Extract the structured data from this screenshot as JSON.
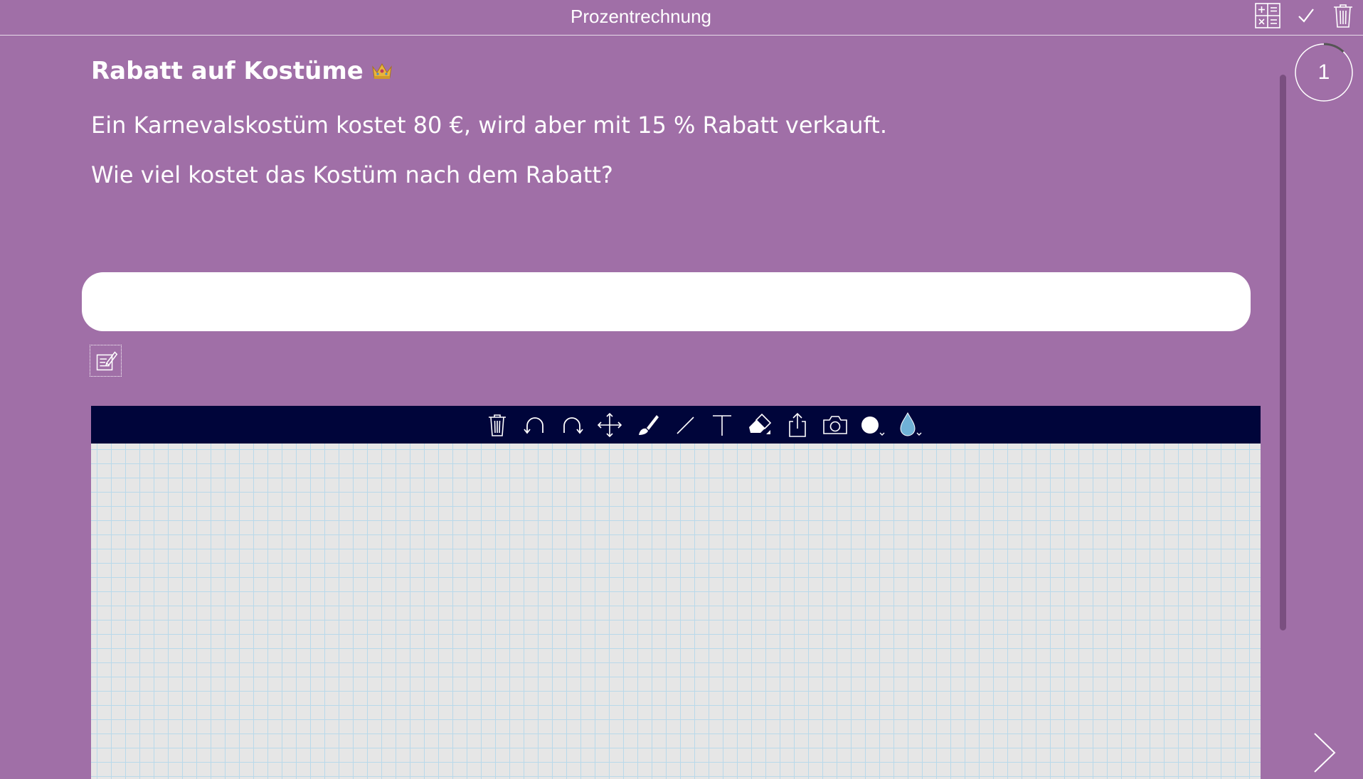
{
  "header": {
    "title": "Prozentrechnung",
    "icons": [
      "calculator-icon",
      "check-icon",
      "trash-icon"
    ]
  },
  "exercise": {
    "title": "Rabatt auf Kostüme",
    "title_emoji": "crown-icon",
    "statement": "Ein Karnevalskostüm kostet 80 €, wird aber mit 15 % Rabatt verkauft.",
    "question": "Wie viel kostet das Kostüm nach dem Rabatt?"
  },
  "answer": {
    "value": "",
    "placeholder": ""
  },
  "drawing": {
    "tools": [
      "trash-icon",
      "undo-icon",
      "redo-icon",
      "move-icon",
      "brush-icon",
      "line-icon",
      "text-icon",
      "eraser-icon",
      "share-icon",
      "camera-icon",
      "stroke-width-icon",
      "color-drop-icon"
    ],
    "active_color": "#ffffff",
    "drop_color": "#6fb1d6"
  },
  "colors": {
    "background": "#a06fa7",
    "toolbar": "#00053a",
    "grid_line": "#b9d9ea",
    "canvas": "#e6e6e6"
  },
  "progress": {
    "number": "1",
    "fraction": 0.12
  }
}
